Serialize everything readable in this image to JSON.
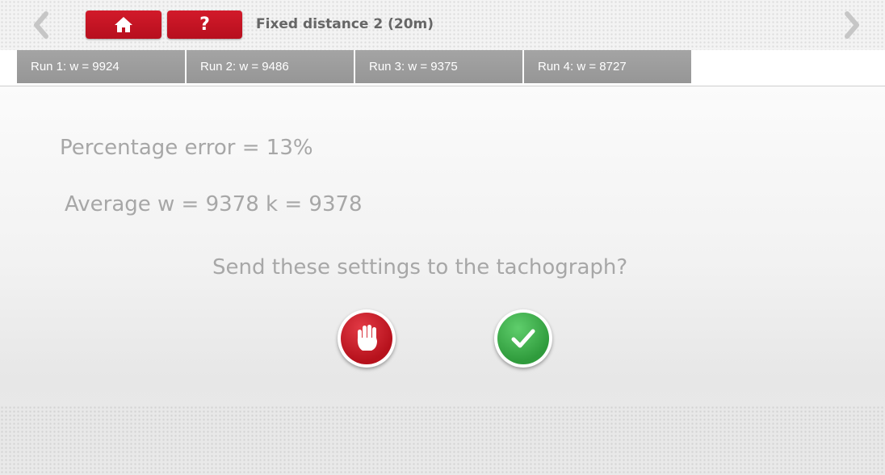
{
  "header": {
    "title": "Fixed distance 2 (20m)",
    "help_label": "?",
    "icons": {
      "back": "chevron-left-icon",
      "forward": "chevron-right-icon",
      "home": "home-icon"
    }
  },
  "runs": [
    {
      "label": "Run 1: w = 9924"
    },
    {
      "label": "Run 2: w = 9486"
    },
    {
      "label": "Run 3: w = 9375"
    },
    {
      "label": "Run 4: w = 8727"
    }
  ],
  "results": {
    "percentage_error": "Percentage error = 13%",
    "average": "Average w = 9378 k = 9378"
  },
  "prompt": {
    "question": "Send these settings to the tachograph?",
    "reject_icon": "stop-hand-icon",
    "accept_icon": "check-icon"
  },
  "colors": {
    "accent_red": "#c8141f",
    "accept_green": "#3fb04c",
    "tab_gray": "#9d9d9d",
    "text_gray": "#a7a7a7"
  }
}
